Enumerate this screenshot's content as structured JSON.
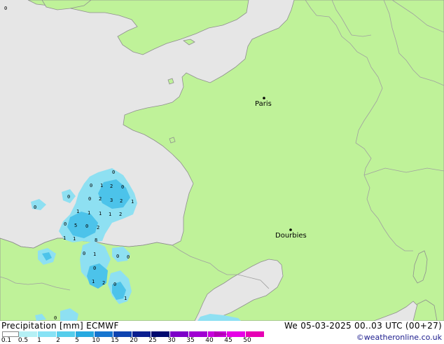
{
  "map": {
    "colors": {
      "sea": "#e6e6e6",
      "land": "#bff299",
      "border": "#a0a0a0",
      "coast": "#8f8f8f",
      "rain_light": "#8ee0f2",
      "rain_mid": "#4cc3ea"
    },
    "cities": [
      {
        "name": "Paris",
        "marker": "city-dot"
      },
      {
        "name": "Dourbies",
        "marker": "city-dot"
      }
    ],
    "precip_values": [
      "0",
      "0",
      "0",
      "1",
      "2",
      "0",
      "0",
      "0",
      "2",
      "3",
      "2",
      "1",
      "0",
      "1",
      "1",
      "1",
      "1",
      "2",
      "0",
      "5",
      "0",
      "2",
      "1",
      "1",
      "8",
      "0",
      "1",
      "0",
      "0",
      "0",
      "1",
      "2",
      "0",
      "1",
      "0"
    ]
  },
  "footer": {
    "title": "Precipitation [mm] ECMWF",
    "datetime": "We 05-03-2025 00..03 UTC (00+27)",
    "credit": "©weatheronline.co.uk",
    "legend": {
      "labels": [
        "0.1",
        "0.5",
        "1",
        "2",
        "5",
        "10",
        "15",
        "20",
        "25",
        "30",
        "35",
        "40",
        "45",
        "50"
      ],
      "colors": [
        "#ffffff",
        "#b5f0f5",
        "#87e2f5",
        "#55cdeb",
        "#26a9e0",
        "#1675cf",
        "#0e44b0",
        "#0b1f8f",
        "#000a6e",
        "#7d00c8",
        "#a000d2",
        "#c800dc",
        "#e600e6",
        "#e600b4"
      ],
      "overflow_color": "#b200b2"
    }
  }
}
